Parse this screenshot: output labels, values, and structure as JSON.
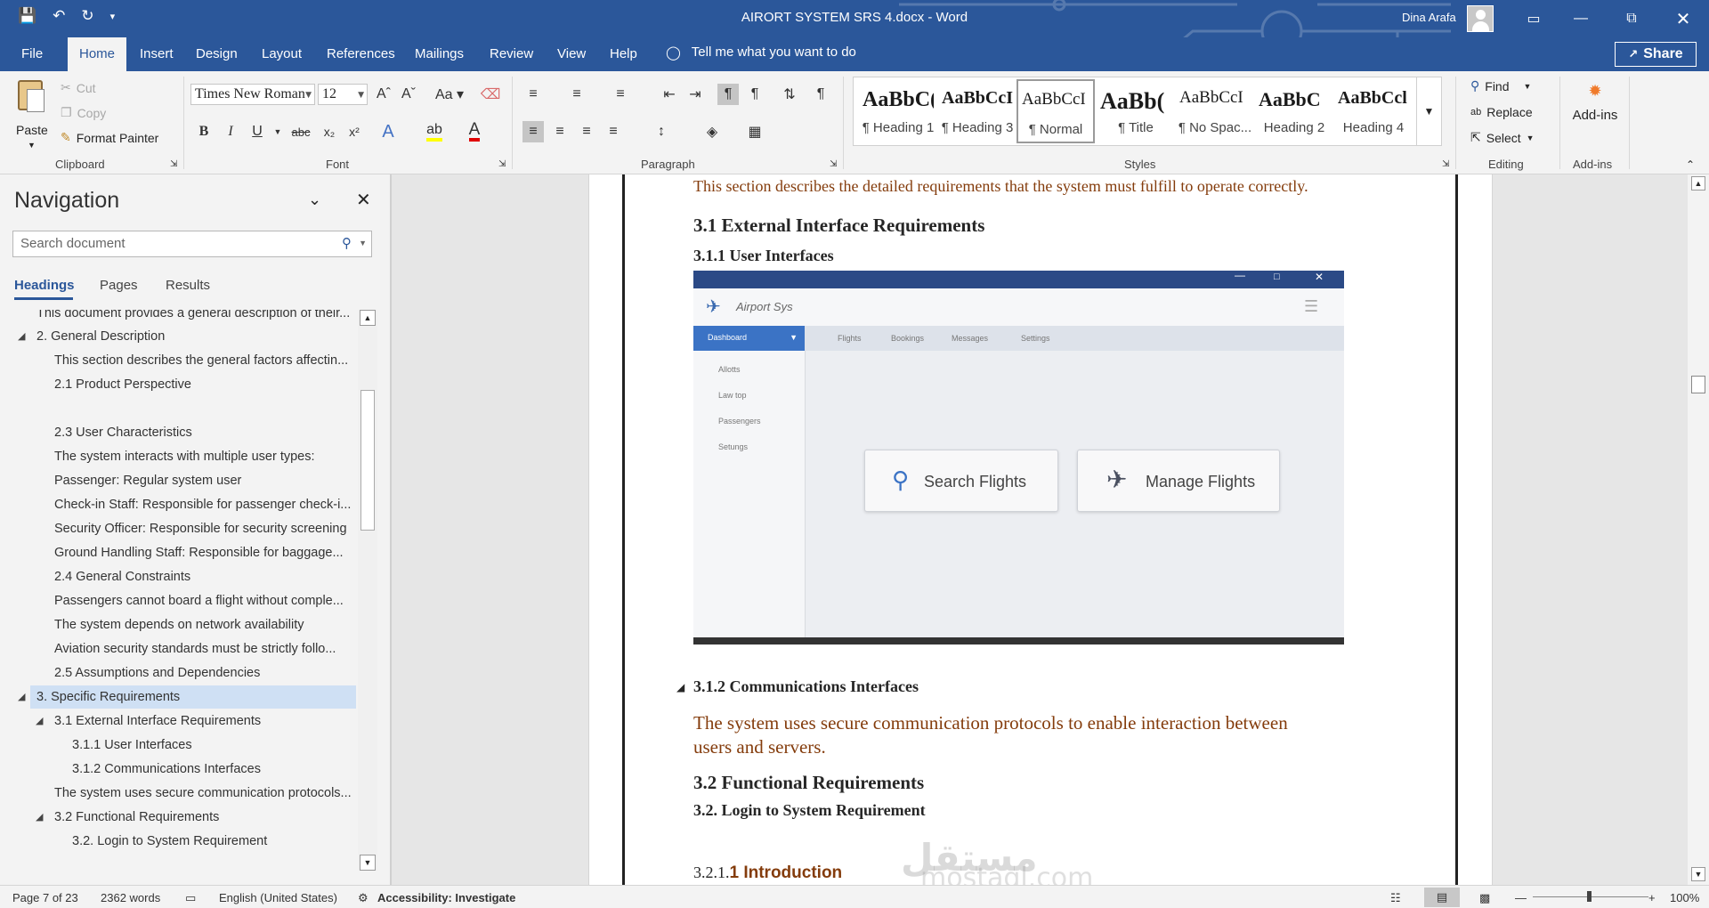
{
  "window": {
    "title": "AIRORT SYSTEM SRS 4.docx  -  Word",
    "user": "Dina Arafa"
  },
  "menu": {
    "tabs": [
      "File",
      "Home",
      "Insert",
      "Design",
      "Layout",
      "References",
      "Mailings",
      "Review",
      "View",
      "Help"
    ],
    "tell_me": "Tell me what you want to do",
    "share": "Share"
  },
  "ribbon": {
    "clipboard": {
      "paste": "Paste",
      "cut": "Cut",
      "copy": "Copy",
      "format_painter": "Format Painter",
      "label": "Clipboard"
    },
    "font": {
      "name": "Times New Roman",
      "size": "12",
      "label": "Font"
    },
    "paragraph": {
      "label": "Paragraph"
    },
    "styles": {
      "label": "Styles",
      "items": [
        {
          "sample": "AaBbC(",
          "name": "¶ Heading 1"
        },
        {
          "sample": "AaBbCcI",
          "name": "¶ Heading 3"
        },
        {
          "sample": "AaBbCcI",
          "name": "¶ Normal"
        },
        {
          "sample": "AaBb(",
          "name": "¶ Title"
        },
        {
          "sample": "AaBbCcI",
          "name": "¶ No Spac..."
        },
        {
          "sample": "AaBbC",
          "name": "Heading 2"
        },
        {
          "sample": "AaBbCcl",
          "name": "Heading 4"
        }
      ]
    },
    "editing": {
      "find": "Find",
      "replace": "Replace",
      "select": "Select",
      "label": "Editing"
    },
    "addins": {
      "button": "Add-ins",
      "label": "Add-ins"
    }
  },
  "nav": {
    "title": "Navigation",
    "search_placeholder": "Search document",
    "tabs": [
      "Headings",
      "Pages",
      "Results"
    ],
    "items": [
      "This document provides a general description of their...",
      "2. General Description",
      "This section describes the general factors affectin...",
      "2.1 Product Perspective",
      "2.3 User Characteristics",
      "The system interacts with multiple user types:",
      "Passenger: Regular system user",
      "Check-in Staff: Responsible for passenger check-i...",
      "Security Officer: Responsible for security screening",
      "Ground Handling Staff: Responsible for baggage...",
      "2.4 General Constraints",
      "Passengers cannot board a flight without comple...",
      "The system depends on network availability",
      "Aviation security standards must be strictly follo...",
      "2.5 Assumptions and Dependencies",
      "3. Specific Requirements",
      "3.1 External Interface Requirements",
      "3.1.1 User Interfaces",
      "3.1.2 Communications Interfaces",
      "The system uses secure communication protocols...",
      "3.2 Functional Requirements",
      "3.2. Login to System Requirement"
    ]
  },
  "document": {
    "intro": "This section describes the detailed requirements that the system must fulfill to operate correctly.",
    "h_31": "3.1 External Interface Requirements",
    "h_311": "3.1.1 User Interfaces",
    "h_312": "3.1.2 Communications Interfaces",
    "comm_text_1": "The system uses secure communication protocols to enable interaction between",
    "comm_text_2": "users and servers.",
    "h_32": "3.2 Functional Requirements",
    "h_32_login": "3.2. Login to System Requirement",
    "h_321_prefix": "3.2.1.",
    "h_321_rest": "1 Introduction",
    "watermark_1": "مستقل",
    "watermark_2": "mostaql.com"
  },
  "figure": {
    "app_name": "Airport Sys",
    "dashboard": "Dashboard",
    "top_nav": [
      "Flights",
      "Bookings",
      "Messages",
      "Settings"
    ],
    "sidebar": [
      "Allotts",
      "Law top",
      "Passengers",
      "Setungs"
    ],
    "btn_search": "Search Flights",
    "btn_manage": "Manage Flights"
  },
  "status": {
    "page": "Page 7 of 23",
    "words": "2362 words",
    "language": "English (United States)",
    "accessibility": "Accessibility: Investigate",
    "zoom": "100%"
  },
  "colors": {
    "accent": "#2b579a",
    "doc_text": "#843c0c",
    "nav_selected": "#cfe0f4"
  }
}
